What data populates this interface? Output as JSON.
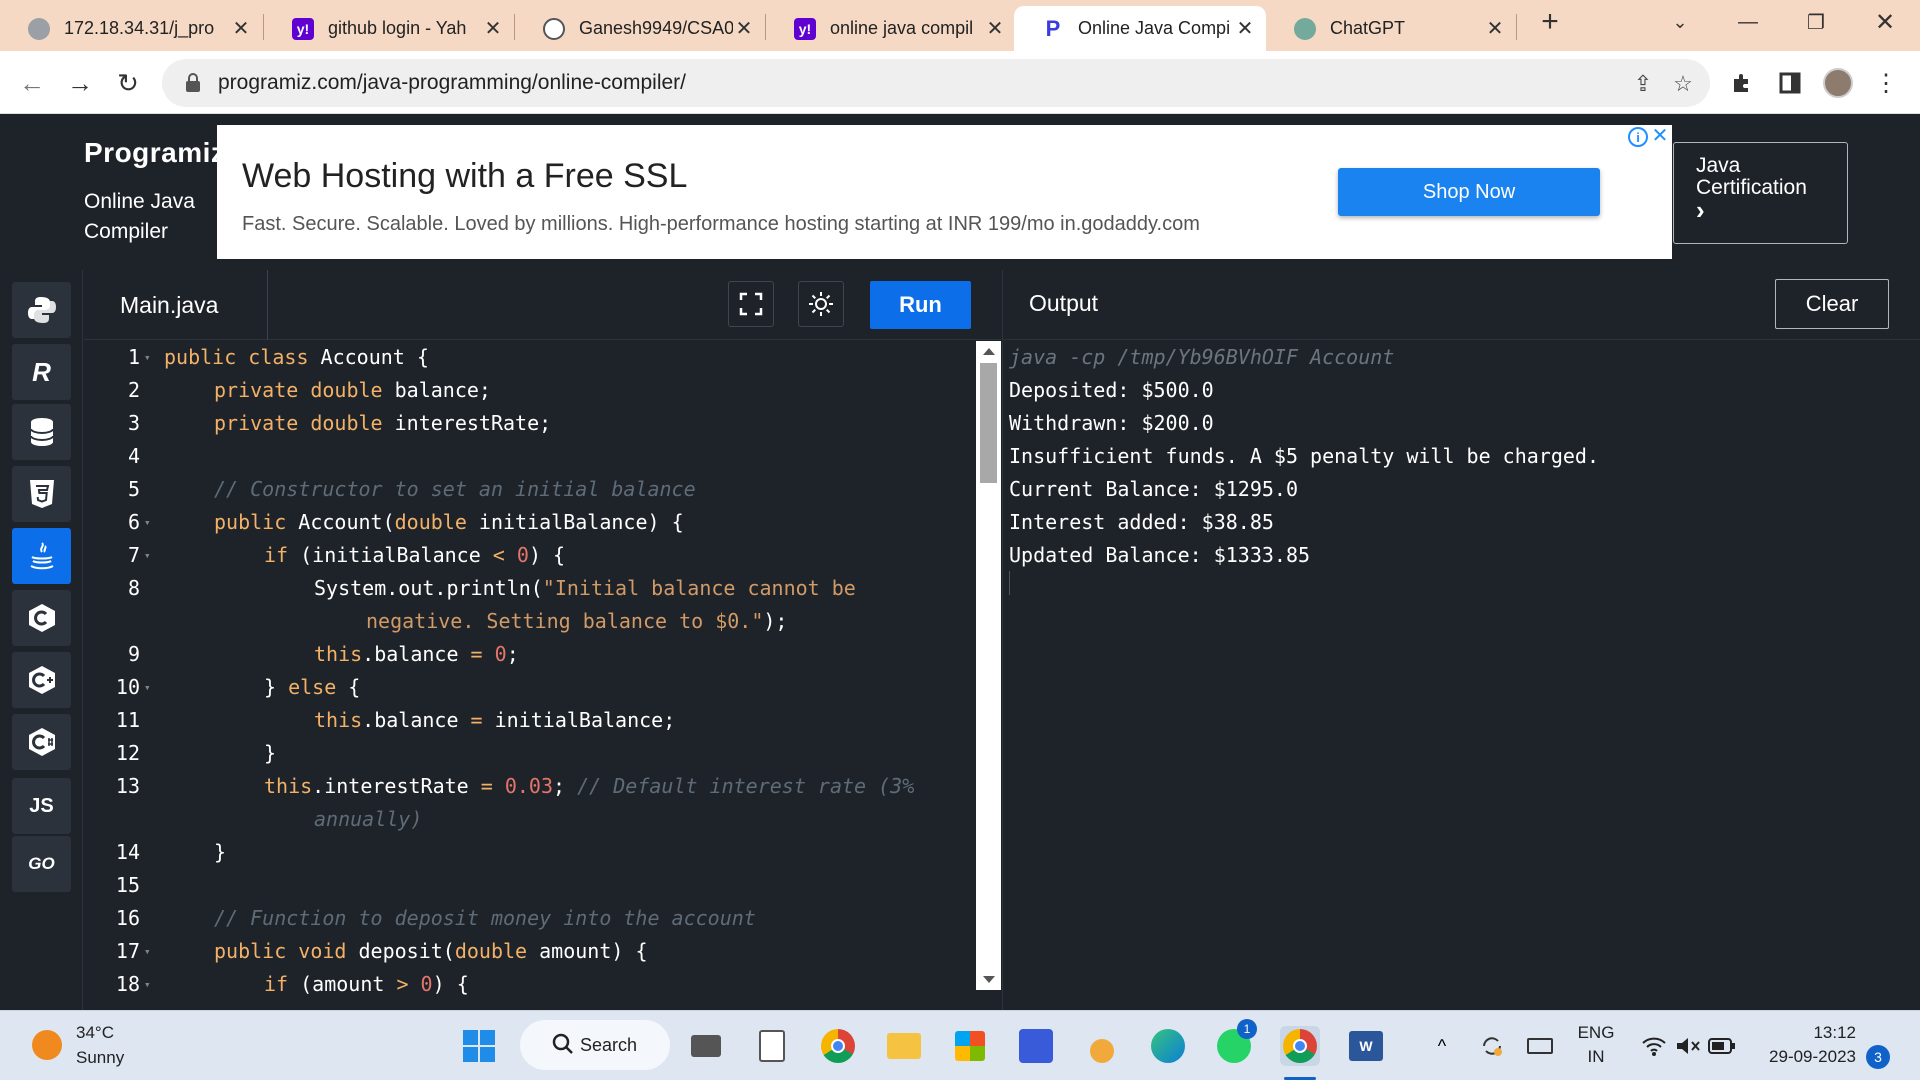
{
  "browser": {
    "tabs": [
      {
        "title": "172.18.34.31/j_pro",
        "icon": "globe-icon",
        "active": false
      },
      {
        "title": "github login - Yah",
        "icon": "yahoo-icon",
        "active": false
      },
      {
        "title": "Ganesh9949/CSA0",
        "icon": "github-icon",
        "active": false
      },
      {
        "title": "online java compil",
        "icon": "yahoo-icon",
        "active": false
      },
      {
        "title": "Online Java Compi",
        "icon": "programiz-icon",
        "active": true
      },
      {
        "title": "ChatGPT",
        "icon": "chatgpt-icon",
        "active": false
      }
    ],
    "url": "programiz.com/java-programming/online-compiler/"
  },
  "site": {
    "logo": "Programiz",
    "subtitle_line1": "Online Java",
    "subtitle_line2": "Compiler",
    "ad": {
      "title": "Web Hosting with a Free SSL",
      "description": "Fast. Secure. Scalable. Loved by millions. High-performance hosting starting at INR 199/mo in.godaddy.com",
      "button": "Shop Now"
    },
    "cert": {
      "line1": "Java",
      "line2": "Certification",
      "arrow": "›"
    }
  },
  "languages": [
    "python",
    "r",
    "sql",
    "html",
    "java",
    "c",
    "cpp",
    "csharp",
    "JS",
    "GO"
  ],
  "editor": {
    "file_name": "Main.java",
    "run_label": "Run",
    "lines": [
      {
        "n": "1",
        "fold": true
      },
      {
        "n": "2"
      },
      {
        "n": "3"
      },
      {
        "n": "4"
      },
      {
        "n": "5"
      },
      {
        "n": "6",
        "fold": true
      },
      {
        "n": "7",
        "fold": true
      },
      {
        "n": "8"
      },
      {
        "n": "9"
      },
      {
        "n": "10",
        "fold": true
      },
      {
        "n": "11"
      },
      {
        "n": "12"
      },
      {
        "n": "13"
      },
      {
        "n": "14"
      },
      {
        "n": "15"
      },
      {
        "n": "16"
      },
      {
        "n": "17",
        "fold": true
      },
      {
        "n": "18",
        "fold": true
      }
    ],
    "code": {
      "l1_kw": "public class",
      "l1_rest": " Account {",
      "l2_kw": "private double",
      "l2_rest": " balance;",
      "l3_kw": "private double",
      "l3_rest": " interestRate;",
      "l5_com": "// Constructor to set an initial balance",
      "l6_kw": "public",
      "l6_a": " Account(",
      "l6_kw2": "double",
      "l6_b": " initialBalance) {",
      "l7_kw": "if",
      "l7_a": " (initialBalance ",
      "l7_op": "<",
      "l7_num": " 0",
      "l7_b": ") {",
      "l8_a": "System.out.println(",
      "l8_str": "\"Initial balance cannot be",
      "l8_str2": "negative. Setting balance to $0.\"",
      "l8_b": ");",
      "l9_kw": "this",
      "l9_a": ".balance ",
      "l9_op": "=",
      "l9_num": " 0",
      "l9_b": ";",
      "l10_a": "} ",
      "l10_kw": "else",
      "l10_b": " {",
      "l11_kw": "this",
      "l11_a": ".balance ",
      "l11_op": "=",
      "l11_b": " initialBalance;",
      "l12": "}",
      "l13_kw": "this",
      "l13_a": ".interestRate ",
      "l13_op": "=",
      "l13_num": " 0.03",
      "l13_b": "; ",
      "l13_com": "// Default interest rate (3%",
      "l13_com2": "annually)",
      "l14": "}",
      "l16_com": "// Function to deposit money into the account",
      "l17_kw": "public void",
      "l17_a": " deposit(",
      "l17_kw2": "double",
      "l17_b": " amount) {",
      "l18_kw": "if",
      "l18_a": " (amount ",
      "l18_op": ">",
      "l18_num": " 0",
      "l18_b": ") {"
    }
  },
  "output": {
    "title": "Output",
    "clear_label": "Clear",
    "command": "java -cp /tmp/Yb96BVhOIF Account",
    "lines": [
      "Deposited: $500.0",
      "Withdrawn: $200.0",
      "Insufficient funds. A $5 penalty will be charged.",
      "Current Balance: $1295.0",
      "Interest added: $38.85",
      "Updated Balance: $1333.85"
    ]
  },
  "taskbar": {
    "weather_temp": "34°C",
    "weather_cond": "Sunny",
    "search_label": "Search",
    "lang_line1": "ENG",
    "lang_line2": "IN",
    "time": "13:12",
    "date": "29-09-2023",
    "notification_count": "3",
    "whatsapp_badge": "1"
  }
}
